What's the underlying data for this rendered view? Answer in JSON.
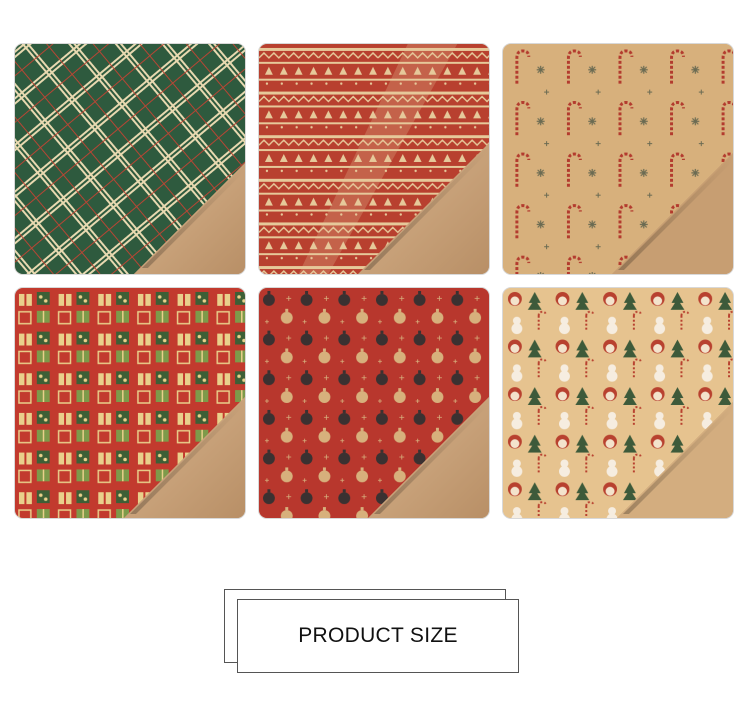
{
  "product_size_label": "PRODUCT SIZE",
  "colors": {
    "kraft": "#c9a47c",
    "plaid_green": "#2f5a3f",
    "christmas_red": "#b4382c",
    "tan_background": "#d9b582"
  },
  "patterns": [
    "green-plaid-paper",
    "red-fair-isle-stripe-paper",
    "candy-cane-snowflake-paper",
    "gift-box-paper",
    "ornament-paper",
    "snowman-santa-tree-paper"
  ]
}
